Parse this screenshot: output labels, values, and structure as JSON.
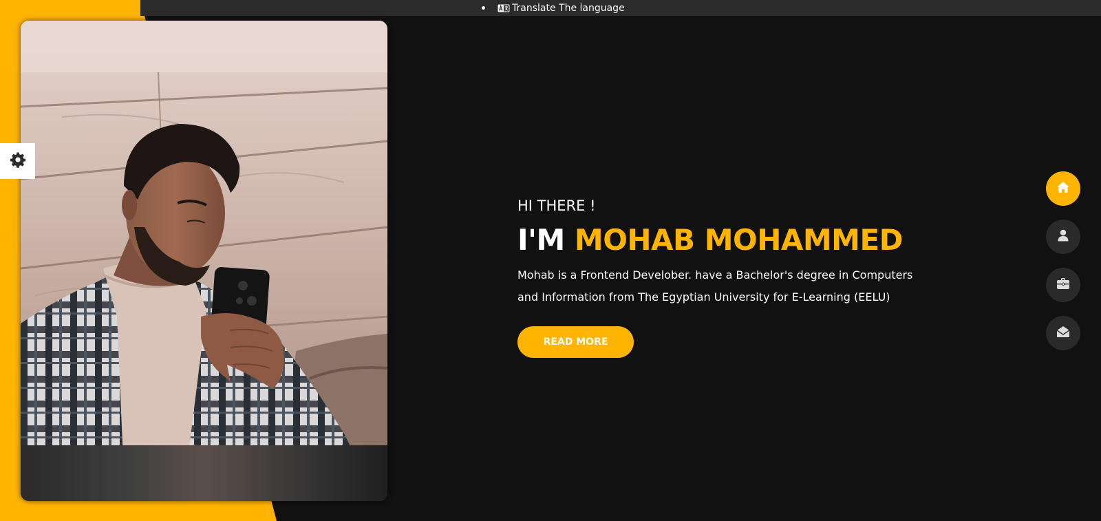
{
  "topbar": {
    "translate_label": "Translate The language"
  },
  "hero": {
    "greeting": "HI THERE !",
    "name_prefix": "I'M",
    "name": "MOHAB MOHAMMED",
    "description": "Mohab is a Frontend Develober. have a Bachelor's degree in Computers and Information from The Egyptian University for E-Learning (EELU)",
    "read_more_label": "READ MORE"
  },
  "side_nav": {
    "items": [
      {
        "icon": "home-icon",
        "active": true
      },
      {
        "icon": "user-icon",
        "active": false
      },
      {
        "icon": "briefcase-icon",
        "active": false
      },
      {
        "icon": "envelope-open-icon",
        "active": false
      }
    ]
  },
  "settings": {
    "icon": "gear-icon"
  },
  "colors": {
    "accent": "#ffb400",
    "background": "#111111",
    "topbar": "#2b2b2b",
    "nav_button": "#2b2a2a"
  }
}
